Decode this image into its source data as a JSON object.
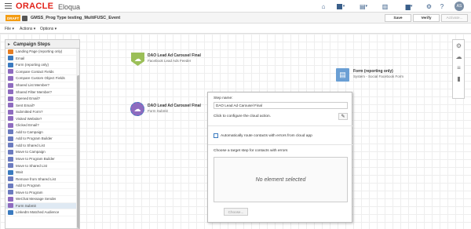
{
  "header": {
    "brand_primary": "ORACLE",
    "brand_secondary": "Eloqua",
    "user_initials": "AS",
    "brand_color": "#e2231a"
  },
  "campaign": {
    "status_badge": "DRAFT",
    "name": "GMSS_Prog Type testing_MultiFUSC_Event",
    "save_label": "Save",
    "verify_label": "Verify",
    "activate_label": "Activate..."
  },
  "menubar": {
    "file": "File ▾",
    "actions": "Actions ▾",
    "options": "Options ▾"
  },
  "steps_panel": {
    "title": "Campaign Steps",
    "items": [
      {
        "label": "Landing Page (reporting only)",
        "color": "#e67e22"
      },
      {
        "label": "Email",
        "color": "#3a7abf"
      },
      {
        "label": "Form (reporting only)",
        "color": "#3a7abf"
      },
      {
        "label": "Compare Contact Fields",
        "color": "#8e6bbf"
      },
      {
        "label": "Compare Custom Object Fields",
        "color": "#8e6bbf"
      },
      {
        "label": "Shared List Member?",
        "color": "#8e6bbf"
      },
      {
        "label": "Shared Filter Member?",
        "color": "#8e6bbf"
      },
      {
        "label": "Opened Email?",
        "color": "#8e6bbf"
      },
      {
        "label": "Sent Email?",
        "color": "#8e6bbf"
      },
      {
        "label": "Submitted Form?",
        "color": "#8e6bbf"
      },
      {
        "label": "Visited Website?",
        "color": "#8e6bbf"
      },
      {
        "label": "Clicked Email?",
        "color": "#8e6bbf"
      },
      {
        "label": "Add to Campaign",
        "color": "#6b7bbf"
      },
      {
        "label": "Add to Program Builder",
        "color": "#6b7bbf"
      },
      {
        "label": "Add to Shared List",
        "color": "#6b7bbf"
      },
      {
        "label": "Move to Campaign",
        "color": "#6b7bbf"
      },
      {
        "label": "Move to Program Builder",
        "color": "#6b7bbf"
      },
      {
        "label": "Move to Shared List",
        "color": "#6b7bbf"
      },
      {
        "label": "Wait",
        "color": "#3a7abf"
      },
      {
        "label": "Remove from Shared List",
        "color": "#6b7bbf"
      },
      {
        "label": "Add to Program",
        "color": "#6b7bbf"
      },
      {
        "label": "Move to Program",
        "color": "#6b7bbf"
      },
      {
        "label": "WeChat Message Sender",
        "color": "#8e6bbf"
      },
      {
        "label": "Form Submit",
        "color": "#8e6bbf",
        "selected": true
      },
      {
        "label": "LinkedIn Matched Audience",
        "color": "#3a7abf"
      }
    ]
  },
  "canvas": {
    "node_feeder": {
      "title": "DAO Lead Ad Carousel Final",
      "subtitle": "Facebook Lead Ads Feeder",
      "color": "#9bbf58"
    },
    "node_form_submit": {
      "title": "DAO Lead Ad Carousel Final",
      "subtitle": "Form Submit",
      "color": "#8e6bbf"
    },
    "node_form": {
      "title": "Form (reporting only)",
      "subtitle": "System - Social Facebook Form",
      "color": "#6a9fd4"
    }
  },
  "config_popup": {
    "step_name_label": "Step name:",
    "step_name_value": "DAO Lead Ad Carousel Final",
    "configure_text": "Click to configure the cloud action.",
    "auto_route_label": "Automatically route contacts with errors from cloud app",
    "target_step_label": "Choose a target step for contacts with errors",
    "empty_text": "No element selected",
    "choose_label": "Choose..."
  }
}
